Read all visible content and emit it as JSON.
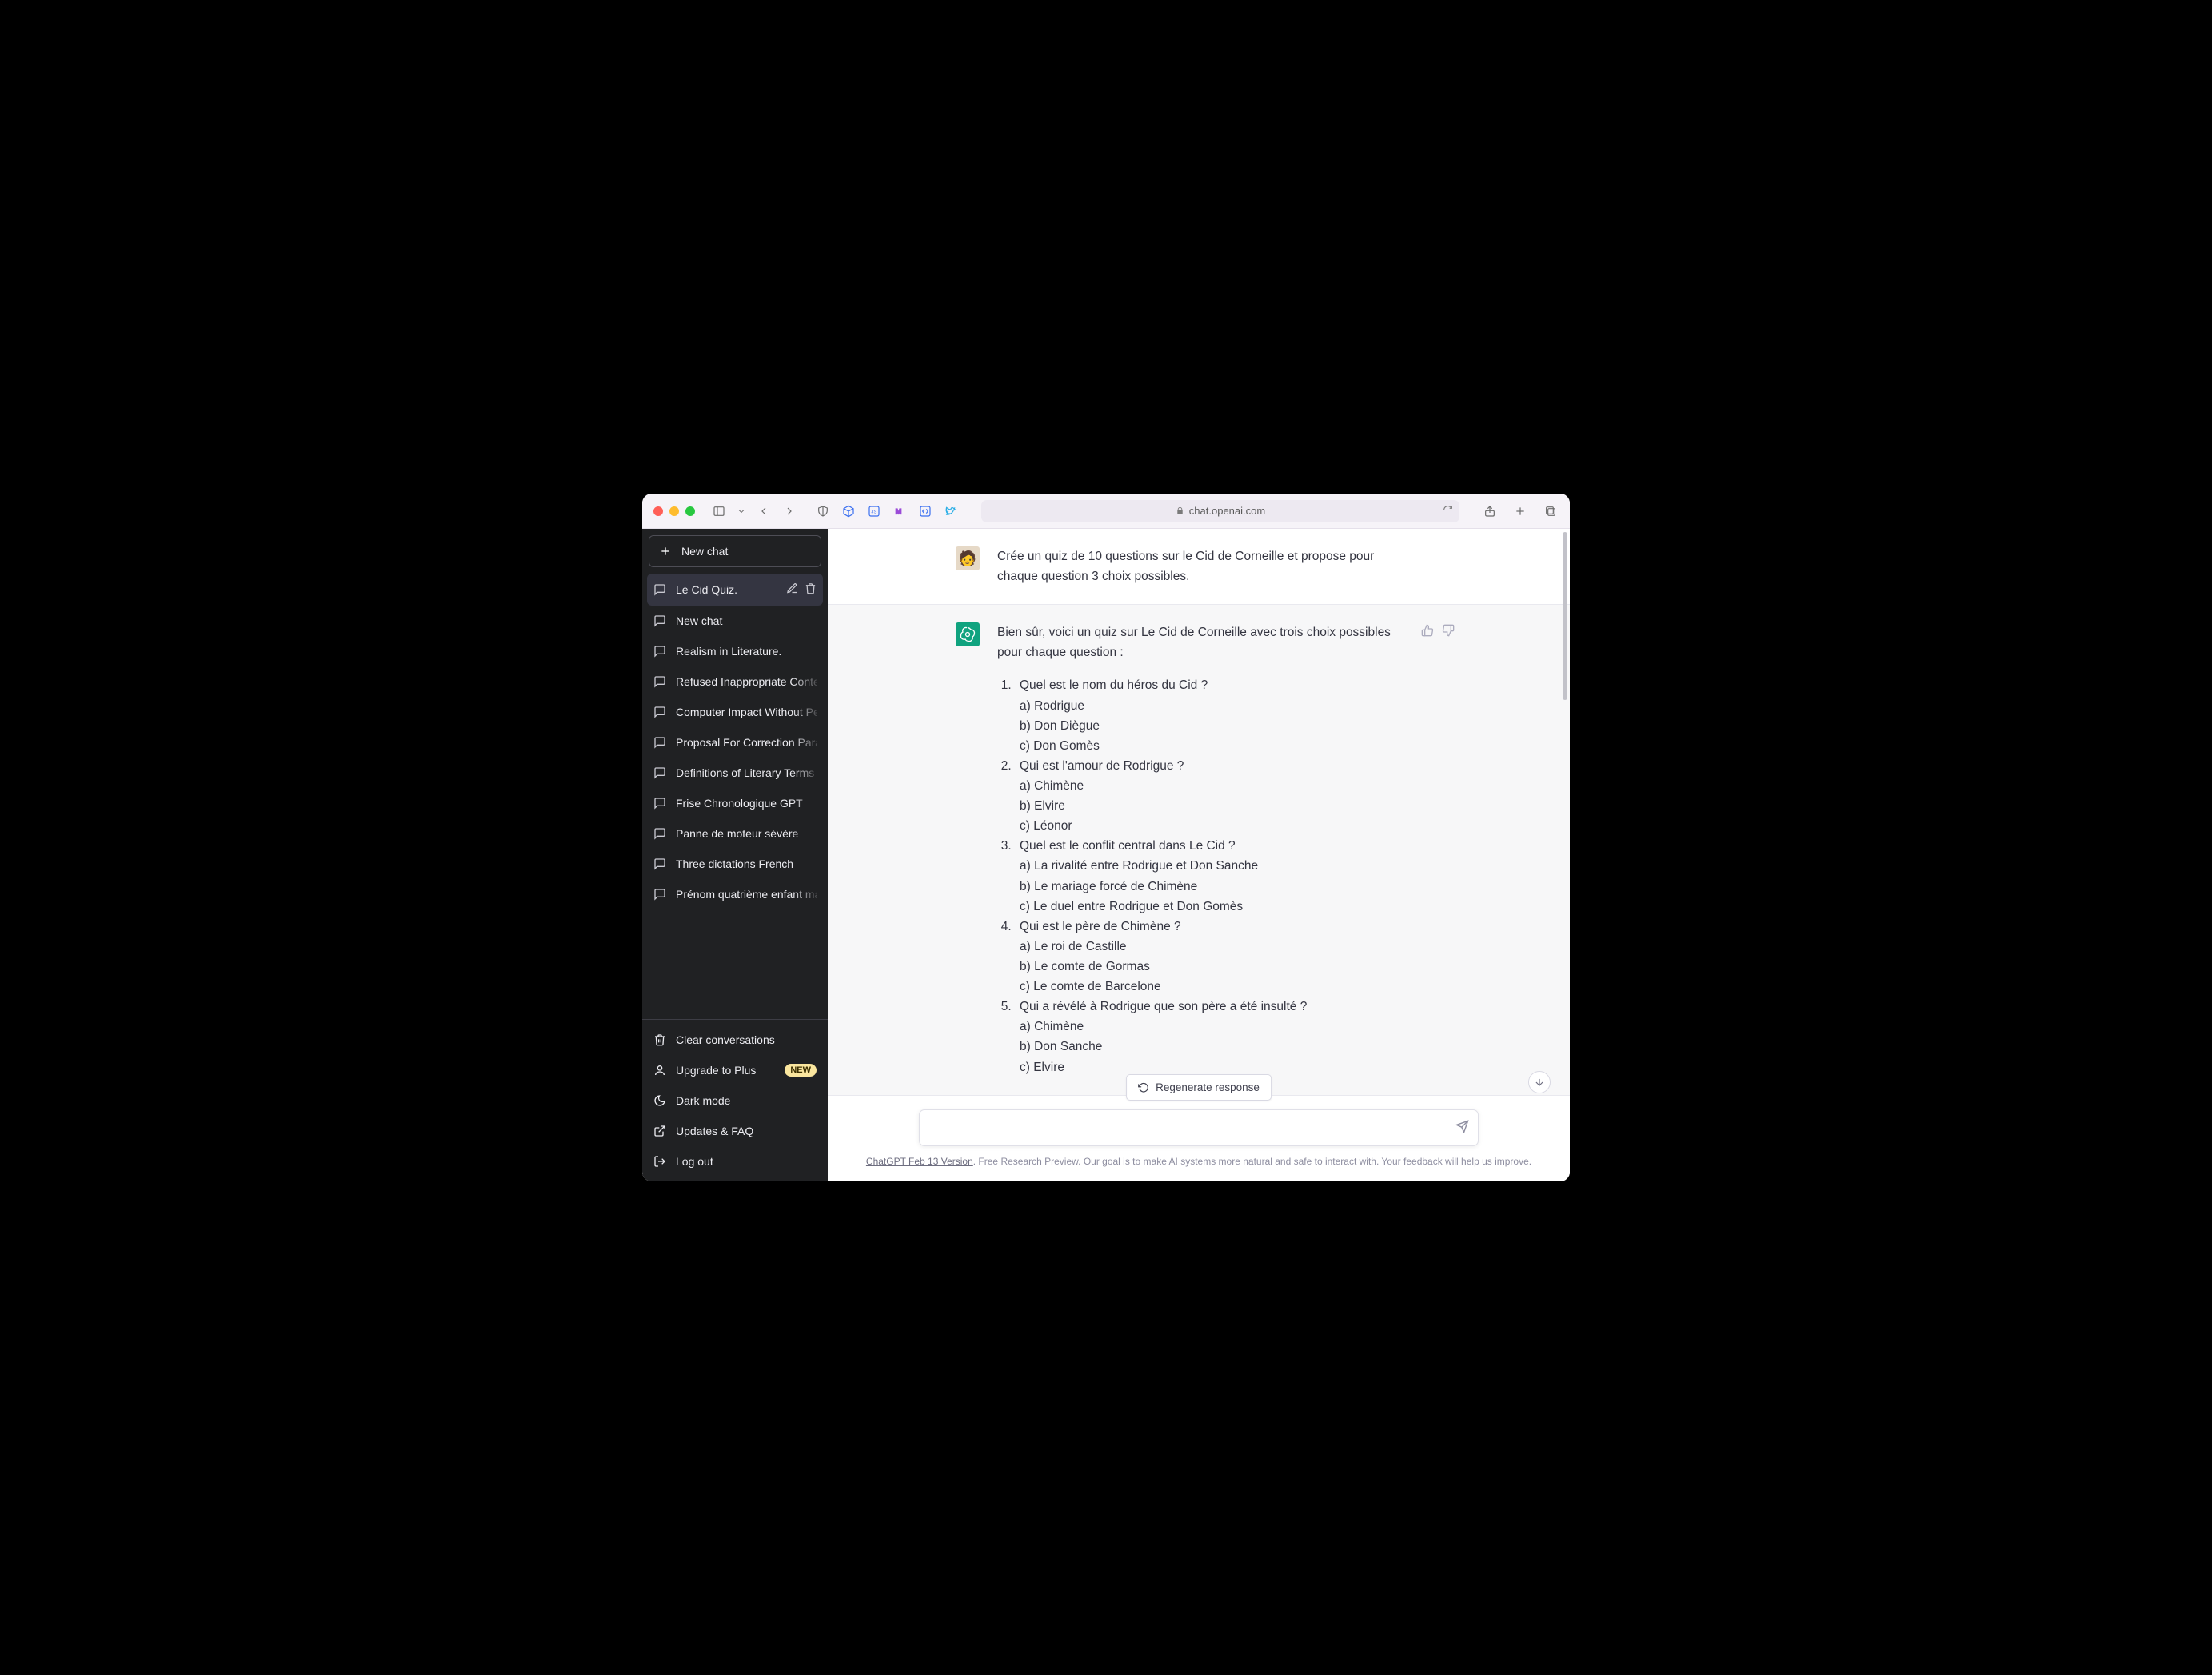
{
  "browser": {
    "url_host": "chat.openai.com"
  },
  "sidebar": {
    "new_chat_label": "New chat",
    "chats": [
      {
        "label": "Le Cid Quiz.",
        "active": true
      },
      {
        "label": "New chat"
      },
      {
        "label": "Realism in Literature."
      },
      {
        "label": "Refused Inappropriate Content"
      },
      {
        "label": "Computer Impact Without Peripherals"
      },
      {
        "label": "Proposal For Correction Paragraph"
      },
      {
        "label": "Definitions of Literary Terms"
      },
      {
        "label": "Frise Chronologique GPT"
      },
      {
        "label": "Panne de moteur sévère"
      },
      {
        "label": "Three dictations French"
      },
      {
        "label": "Prénom quatrième enfant manquant"
      }
    ],
    "bottom": {
      "clear": "Clear conversations",
      "upgrade": "Upgrade to Plus",
      "upgrade_badge": "NEW",
      "dark": "Dark mode",
      "faq": "Updates & FAQ",
      "logout": "Log out"
    }
  },
  "conversation": {
    "user_msg": "Crée un quiz de 10 questions sur le Cid de Corneille et propose pour chaque question 3 choix possibles.",
    "assistant_intro": "Bien sûr, voici un quiz sur Le Cid de Corneille avec trois choix possibles pour chaque question :",
    "questions": [
      {
        "q": "Quel est le nom du héros du Cid ?",
        "choices": [
          "a) Rodrigue",
          "b) Don Diègue",
          "c) Don Gomès"
        ]
      },
      {
        "q": "Qui est l'amour de Rodrigue ?",
        "choices": [
          "a) Chimène",
          "b) Elvire",
          "c) Léonor"
        ]
      },
      {
        "q": "Quel est le conflit central dans Le Cid ?",
        "choices": [
          "a) La rivalité entre Rodrigue et Don Sanche",
          "b) Le mariage forcé de Chimène",
          "c) Le duel entre Rodrigue et Don Gomès"
        ]
      },
      {
        "q": "Qui est le père de Chimène ?",
        "choices": [
          "a) Le roi de Castille",
          "b) Le comte de Gormas",
          "c) Le comte de Barcelone"
        ]
      },
      {
        "q": "Qui a révélé à Rodrigue que son père a été insulté ?",
        "choices": [
          "a) Chimène",
          "b) Don Sanche",
          "c) Elvire"
        ]
      }
    ]
  },
  "composer": {
    "regen_label": "Regenerate response",
    "placeholder": ""
  },
  "footer": {
    "version_label": "ChatGPT Feb 13 Version",
    "rest": ". Free Research Preview. Our goal is to make AI systems more natural and safe to interact with. Your feedback will help us improve."
  }
}
